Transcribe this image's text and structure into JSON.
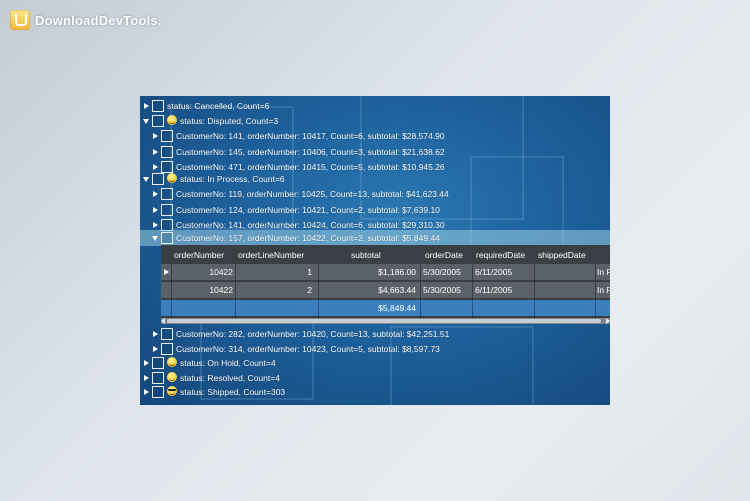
{
  "watermark": {
    "text": "DownloadDevTools."
  },
  "tree": {
    "rows": [
      {
        "text": "status: Cancelled, Count=6"
      },
      {
        "text": "status: Disputed, Count=3"
      },
      {
        "text": "CustomerNo: 141, orderNumber: 10417, Count=6, subtotal: $28,574.90"
      },
      {
        "text": "CustomerNo: 145, orderNumber: 10406, Count=3, subtotal: $21,638.62"
      },
      {
        "text": "CustomerNo: 471, orderNumber: 10415, Count=5, subtotal: $10,945.26"
      },
      {
        "text": "status: In Process, Count=6"
      },
      {
        "text": "CustomerNo: 119, orderNumber: 10425, Count=13, subtotal: $41,623.44"
      },
      {
        "text": "CustomerNo: 124, orderNumber: 10421, Count=2, subtotal: $7,639.10"
      },
      {
        "text": "CustomerNo: 141, orderNumber: 10424, Count=6, subtotal: $29,310.30"
      },
      {
        "text": "CustomerNo: 157, orderNumber: 10422, Count=2, subtotal: $5,849.44"
      },
      {
        "text": "CustomerNo: 282, orderNumber: 10420, Count=13, subtotal: $42,251.51"
      },
      {
        "text": "CustomerNo: 314, orderNumber: 10423, Count=5, subtotal: $8,597.73"
      },
      {
        "text": "status: On Hold, Count=4"
      },
      {
        "text": "status: Resolved, Count=4"
      },
      {
        "text": "status: Shipped, Count=303"
      }
    ]
  },
  "detail_grid": {
    "columns": [
      "orderNumber",
      "orderLineNumber",
      "subtotal",
      "orderDate",
      "requiredDate",
      "shippedDate"
    ],
    "rows": [
      [
        "10422",
        "1",
        "$1,186.00",
        "5/30/2005",
        "6/11/2005",
        "",
        "In P"
      ],
      [
        "10422",
        "2",
        "$4,663.44",
        "5/30/2005",
        "6/11/2005",
        "",
        "In P"
      ]
    ],
    "summary": {
      "subtotal": "$5,849.44"
    }
  }
}
